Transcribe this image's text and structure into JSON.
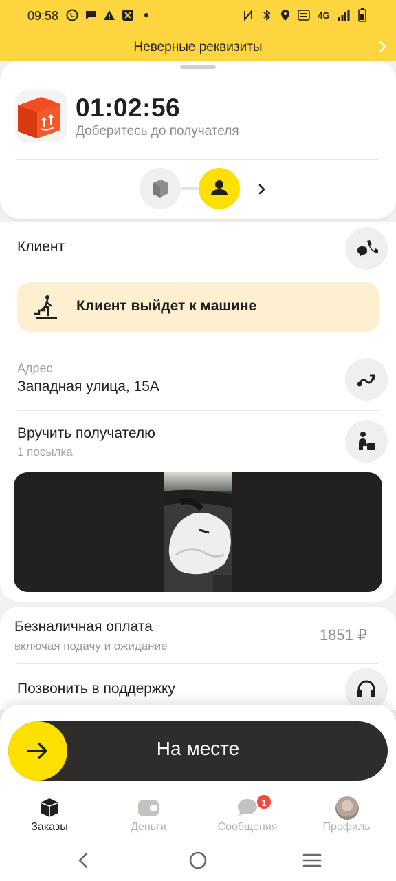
{
  "status_bar": {
    "time": "09:58",
    "left_icons": [
      "whatsapp-icon",
      "message-icon",
      "warning-icon",
      "app-icon",
      "dot-icon"
    ],
    "right_icons": [
      "nfc-icon",
      "bluetooth-icon",
      "location-icon",
      "volte-icon",
      "4g-icon",
      "signal-icon",
      "battery-icon"
    ],
    "network_label": "4G"
  },
  "banner": {
    "text": "Неверные реквизиты"
  },
  "order_header": {
    "timer": "01:02:56",
    "subtitle": "Доберитесь до получателя",
    "steps": [
      {
        "icon": "package-icon",
        "active": false
      },
      {
        "icon": "person-icon",
        "active": true
      }
    ]
  },
  "client": {
    "label": "Клиент",
    "notice": "Клиент выйдет к машине"
  },
  "address": {
    "label": "Адрес",
    "value": "Западная улица, 15А"
  },
  "delivery": {
    "title": "Вручить получателю",
    "subtitle": "1 посылка"
  },
  "payment": {
    "title": "Безналичная оплата",
    "subtitle": "включая подачу и ожидание",
    "amount": "1851 ₽"
  },
  "support": {
    "label": "Позвонить в поддержку"
  },
  "action_slider": {
    "label": "На месте"
  },
  "tabs": [
    {
      "label": "Заказы",
      "icon": "orders-icon",
      "active": true
    },
    {
      "label": "Деньги",
      "icon": "wallet-icon",
      "active": false
    },
    {
      "label": "Сообщения",
      "icon": "chat-icon",
      "active": false,
      "badge": "1"
    },
    {
      "label": "Профиль",
      "icon": "avatar",
      "active": false
    }
  ],
  "colors": {
    "accent_yellow": "#fce000",
    "banner_yellow": "#fcd53f",
    "notice_bg": "#fdefd0",
    "slider_dark": "#2f2d2b",
    "badge_red": "#f5483b"
  }
}
